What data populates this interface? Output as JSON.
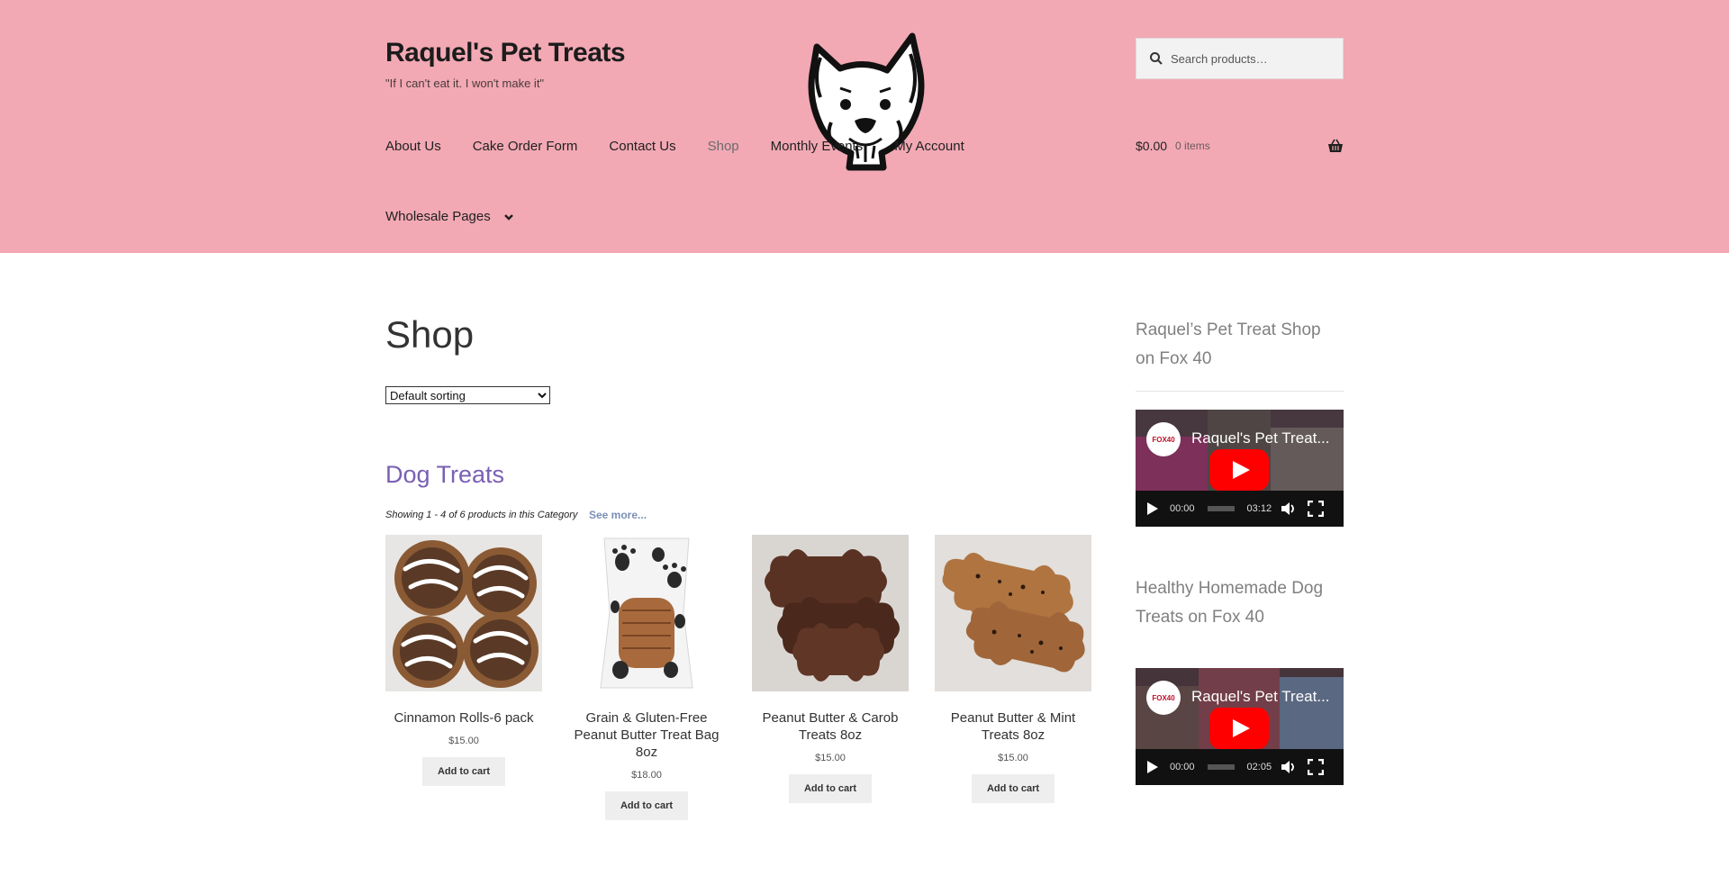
{
  "header": {
    "site_title": "Raquel's Pet Treats",
    "tagline": "\"If I can't eat it. I won't make it\"",
    "search_placeholder": "Search products…",
    "nav": [
      "About Us",
      "Cake Order Form",
      "Contact Us",
      "Shop",
      "Monthly Events",
      "My Account"
    ],
    "nav_active": "Shop",
    "nav_secondary": "Wholesale Pages",
    "cart_amount": "$0.00",
    "cart_count": "0 items",
    "colors": {
      "header_bg": "#f2a9b4",
      "category": "#7a5fb4"
    }
  },
  "main": {
    "page_title": "Shop",
    "sort_selected": "Default sorting",
    "category_title": "Dog Treats",
    "showing": "Showing 1 - 4 of 6 products in this Category",
    "see_more": "See more...",
    "products": [
      {
        "name": "Cinnamon Rolls-6 pack",
        "price": "$15.00",
        "button": "Add to cart"
      },
      {
        "name": "Grain & Gluten-Free Peanut Butter Treat Bag 8oz",
        "price": "$18.00",
        "button": "Add to cart"
      },
      {
        "name": "Peanut Butter & Carob Treats 8oz",
        "price": "$15.00",
        "button": "Add to cart"
      },
      {
        "name": "Peanut Butter & Mint Treats 8oz",
        "price": "$15.00",
        "button": "Add to cart"
      }
    ]
  },
  "sidebar": {
    "widgets": [
      {
        "title": "Raquel’s Pet Treat Shop on Fox 40",
        "video_title": "Raquel's Pet Treat...",
        "time_current": "00:00",
        "time_total": "03:12"
      },
      {
        "title": "Healthy Homemade Dog Treats on Fox 40",
        "video_title": "Raquel's Pet Treat...",
        "time_current": "00:00",
        "time_total": "02:05"
      }
    ],
    "channel_logo_text": "FOX40"
  }
}
